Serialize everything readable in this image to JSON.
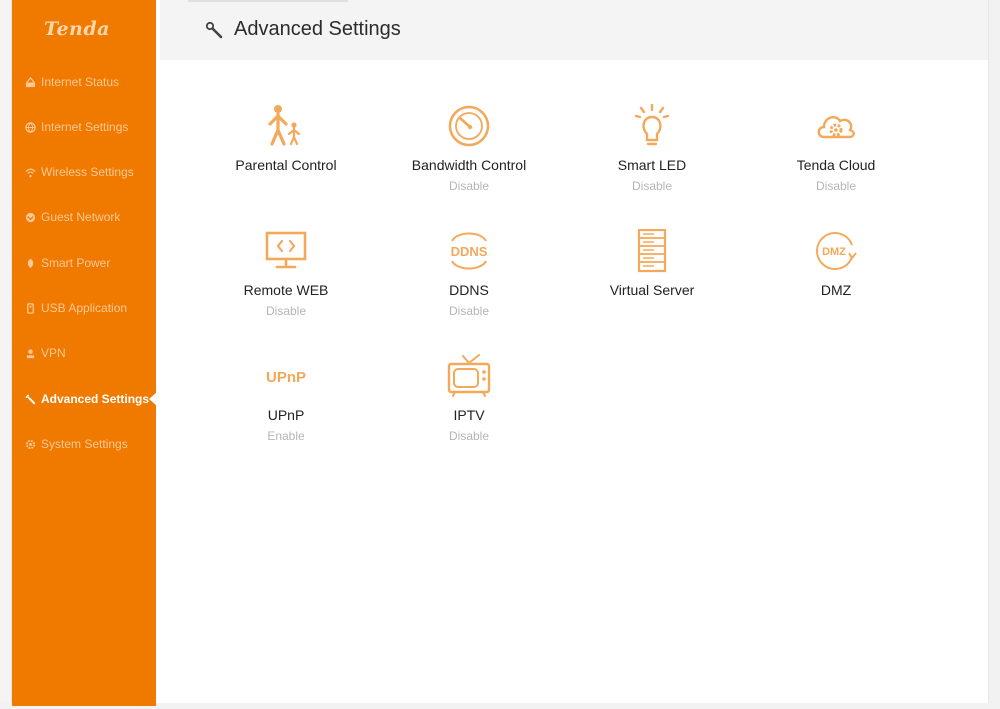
{
  "brand": {
    "logo_text": "Tenda",
    "accent": "#f07a00"
  },
  "sidebar": {
    "items": [
      {
        "label": "Internet Status",
        "icon": "network-status-icon",
        "active": false
      },
      {
        "label": "Internet Settings",
        "icon": "globe-icon",
        "active": false
      },
      {
        "label": "Wireless Settings",
        "icon": "wifi-icon",
        "active": false
      },
      {
        "label": "Guest Network",
        "icon": "guest-icon",
        "active": false
      },
      {
        "label": "Smart Power",
        "icon": "leaf-icon",
        "active": false
      },
      {
        "label": "USB Application",
        "icon": "usb-icon",
        "active": false
      },
      {
        "label": "VPN",
        "icon": "vpn-icon",
        "active": false
      },
      {
        "label": "Advanced Settings",
        "icon": "wrench-icon",
        "active": true
      },
      {
        "label": "System Settings",
        "icon": "gear-icon",
        "active": false
      }
    ]
  },
  "header": {
    "title": "Advanced Settings",
    "icon": "wrench-icon"
  },
  "features": [
    {
      "label": "Parental Control",
      "status": "",
      "icon": "parent-child-icon"
    },
    {
      "label": "Bandwidth Control",
      "status": "Disable",
      "icon": "speedometer-icon"
    },
    {
      "label": "Smart LED",
      "status": "Disable",
      "icon": "light-bulb-icon"
    },
    {
      "label": "Tenda Cloud",
      "status": "Disable",
      "icon": "cloud-gear-icon"
    },
    {
      "label": "Remote WEB",
      "status": "Disable",
      "icon": "monitor-code-icon"
    },
    {
      "label": "DDNS",
      "status": "Disable",
      "icon": "ddns-icon",
      "icon_text": "DDNS"
    },
    {
      "label": "Virtual Server",
      "status": "",
      "icon": "server-icon"
    },
    {
      "label": "DMZ",
      "status": "",
      "icon": "dmz-icon",
      "icon_text": "DMZ"
    },
    {
      "label": "UPnP",
      "status": "Enable",
      "icon": "upnp-icon",
      "icon_text": "UPnP"
    },
    {
      "label": "IPTV",
      "status": "Disable",
      "icon": "tv-icon"
    }
  ]
}
